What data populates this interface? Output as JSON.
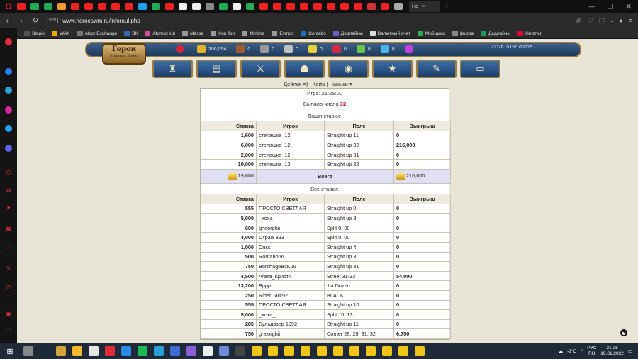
{
  "browser": {
    "active_tab_label": "Не",
    "url": "www.heroeswm.ru/inforoul.php",
    "vpn_badge": "VPN",
    "bookmarks": [
      {
        "label": "Stepik",
        "color": "#555555"
      },
      {
        "label": "WAX",
        "color": "#f2a900"
      },
      {
        "label": "Alcor Exchange",
        "color": "#777777"
      },
      {
        "label": "ВК",
        "color": "#2f6eb5"
      },
      {
        "label": "AtomicHub",
        "color": "#d94aa1"
      },
      {
        "label": "Massa",
        "color": "#999999"
      },
      {
        "label": "Iron fish",
        "color": "#999999"
      },
      {
        "label": "Minima",
        "color": "#999999"
      },
      {
        "label": "Evmos",
        "color": "#999999"
      },
      {
        "label": "Contabo",
        "color": "#1b6fbe"
      },
      {
        "label": "Дедлайны",
        "color": "#6a5acd"
      },
      {
        "label": "Валютный счет",
        "color": "#dddddd"
      },
      {
        "label": "Мой диск",
        "color": "#2fa84f"
      },
      {
        "label": "физра",
        "color": "#888888"
      },
      {
        "label": "Дедлайны",
        "color": "#1f9d55"
      },
      {
        "label": "Hetzner",
        "color": "#d50c2d"
      }
    ]
  },
  "game": {
    "logo_line1": "Герои",
    "logo_line2": "Войны и Денег",
    "resources": [
      {
        "name": "gold",
        "value": "266,094",
        "color": "#e3b428"
      },
      {
        "name": "wood",
        "value": "0",
        "color": "#a05a2c"
      },
      {
        "name": "ore",
        "value": "0",
        "color": "#9a9a9a"
      },
      {
        "name": "mercury",
        "value": "0",
        "color": "#c0c0c0"
      },
      {
        "name": "sulfur",
        "value": "0",
        "color": "#e8d33a"
      },
      {
        "name": "crystals",
        "value": "0",
        "color": "#d02a48"
      },
      {
        "name": "gems",
        "value": "0",
        "color": "#68c14a"
      },
      {
        "name": "diamonds",
        "value": "0",
        "color": "#4bb3e8"
      }
    ],
    "server_time": "21:26",
    "online": "5156 online",
    "nav_icons": [
      "castle-icon",
      "map-icon",
      "battle-icon",
      "tavern-icon",
      "market-icon",
      "rating-icon",
      "scroll-icon",
      "chat-icon"
    ],
    "subnav_text": "Дейлик =) | Karta | Навыки ▾"
  },
  "roulette": {
    "game_time": "Игра: 21:25:00",
    "result_label": "Выпало число",
    "result_number": "32",
    "your_bets_title": "Ваши ставки:",
    "all_bets_title": "Все ставки:",
    "columns": [
      "Ставка",
      "Игрок",
      "Поле",
      "Выигрыш"
    ],
    "your_bets": [
      {
        "bet": "1,600",
        "player": "степашка_12",
        "field": "Straight up 11",
        "win": "0"
      },
      {
        "bet": "6,000",
        "player": "степашка_12",
        "field": "Straight up 32",
        "win": "216,000"
      },
      {
        "bet": "2,000",
        "player": "степашка_12",
        "field": "Straight up 31",
        "win": "0"
      },
      {
        "bet": "10,000",
        "player": "степашка_12",
        "field": "Straight up 22",
        "win": "0"
      }
    ],
    "total": {
      "bet": "19,600",
      "label": "Всего",
      "win": "216,000"
    },
    "all_bets": [
      {
        "bet": "555",
        "player": "ПРОСТО СВЕТЛАЯ",
        "field": "Straight up 0",
        "win": "0"
      },
      {
        "bet": "5,000",
        "player": "_xoxa_",
        "field": "Straight up 8",
        "win": "0"
      },
      {
        "bet": "600",
        "player": "gheorghii",
        "field": "Split 0, 00",
        "win": "0"
      },
      {
        "bet": "4,000",
        "player": "Страж 333",
        "field": "Split 0, 00",
        "win": "0"
      },
      {
        "bet": "1,000",
        "player": "Criss",
        "field": "Straight up 4",
        "win": "0"
      },
      {
        "bet": "500",
        "player": "Romano66",
        "field": "Straight up 3",
        "win": "0"
      },
      {
        "bet": "750",
        "player": "BorchagoBcKuu",
        "field": "Straight up 31",
        "win": "0"
      },
      {
        "bet": "4,500",
        "player": "Агата_Кристи",
        "field": "Street 31-33",
        "win": "54,000"
      },
      {
        "bet": "13,200",
        "player": "Бррр",
        "field": "1st Dozen",
        "win": "0"
      },
      {
        "bet": "250",
        "player": "RiderDark92",
        "field": "BLACK",
        "win": "0"
      },
      {
        "bet": "555",
        "player": "ПРОСТО СВЕТЛАЯ",
        "field": "Straight up 10",
        "win": "0"
      },
      {
        "bet": "5,000",
        "player": "_xoxa_",
        "field": "Split 10, 13",
        "win": "0"
      },
      {
        "bet": "285",
        "player": "Бульдозер 1992",
        "field": "Straight up 11",
        "win": "0"
      },
      {
        "bet": "750",
        "player": "gheorghii",
        "field": "Corner 28, 29, 31, 32",
        "win": "6,750"
      }
    ]
  },
  "taskbar": {
    "weather": "-2°C",
    "lang_line1": "РУС",
    "lang_line2": "RU",
    "time": "21:26",
    "date": "16.01.2022"
  }
}
